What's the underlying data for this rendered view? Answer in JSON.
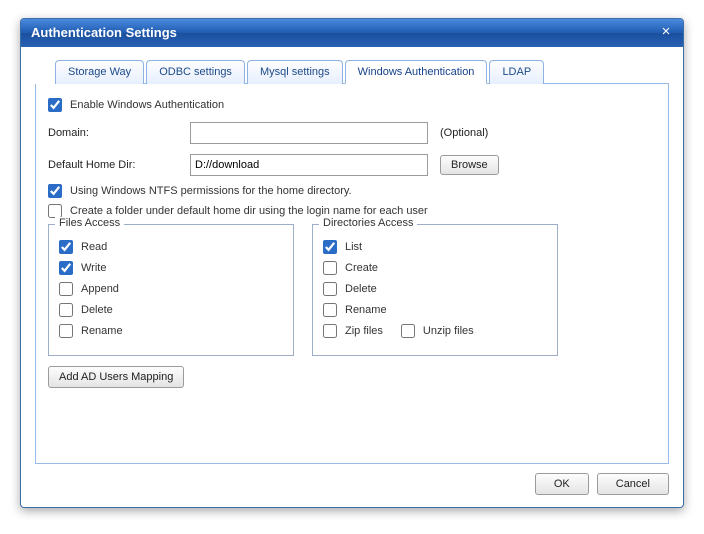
{
  "title": "Authentication Settings",
  "tabs": {
    "storage": "Storage Way",
    "odbc": "ODBC settings",
    "mysql": "Mysql settings",
    "winauth": "Windows Authentication",
    "ldap": "LDAP"
  },
  "enable_label": "Enable Windows Authentication",
  "domain_label": "Domain:",
  "domain_value": "",
  "optional": "(Optional)",
  "homedir_label": "Default Home Dir:",
  "homedir_value": "D://download",
  "browse": "Browse",
  "ntfs_label": "Using Windows NTFS permissions for the home directory.",
  "folder_label": "Create a folder under default home dir using the login name for each user",
  "files_access_title": "Files Access",
  "dirs_access_title": "Directories Access",
  "files": {
    "read": "Read",
    "write": "Write",
    "append": "Append",
    "delete": "Delete",
    "rename": "Rename"
  },
  "dirs": {
    "list": "List",
    "create": "Create",
    "delete": "Delete",
    "rename": "Rename"
  },
  "zip": "Zip files",
  "unzip": "Unzip files",
  "add_mapping": "Add AD Users Mapping",
  "ok": "OK",
  "cancel": "Cancel"
}
